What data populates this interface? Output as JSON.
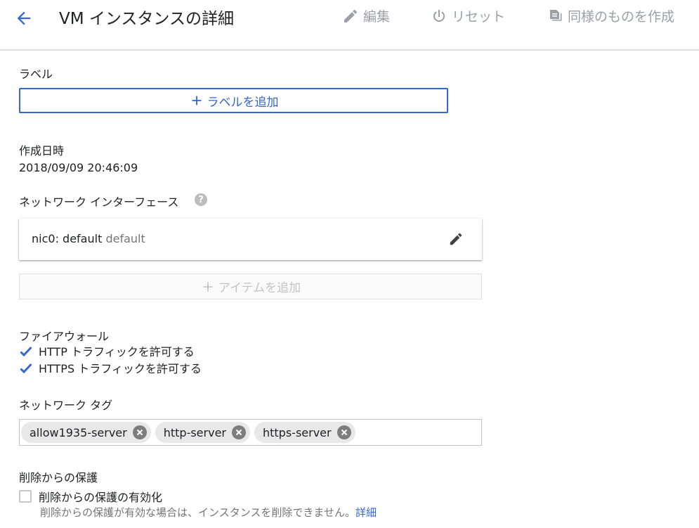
{
  "header": {
    "title": "VM インスタンスの詳細",
    "edit_label": "編集",
    "reset_label": "リセット",
    "clone_label": "同様のものを作成"
  },
  "labels": {
    "heading": "ラベル",
    "add_button": "ラベルを追加"
  },
  "created": {
    "heading": "作成日時",
    "value": "2018/09/09 20:46:09"
  },
  "network_interfaces": {
    "heading": "ネットワーク インターフェース",
    "items": [
      {
        "name": "nic0: default",
        "network": "default"
      }
    ],
    "add_item_button": "アイテムを追加"
  },
  "firewall": {
    "heading": "ファイアウォール",
    "options": [
      {
        "label": "HTTP トラフィックを許可する",
        "checked": true
      },
      {
        "label": "HTTPS トラフィックを許可する",
        "checked": true
      }
    ]
  },
  "network_tags": {
    "heading": "ネットワーク タグ",
    "tags": [
      "allow1935-server",
      "http-server",
      "https-server"
    ]
  },
  "deletion_protection": {
    "heading": "削除からの保護",
    "option_label": "削除からの保護の有効化",
    "checked": false,
    "hint": "削除からの保護が有効な場合は、インスタンスを削除できません。",
    "hint_link": "詳細"
  },
  "colors": {
    "accent": "#3367d6",
    "muted": "#9aa0a6"
  }
}
